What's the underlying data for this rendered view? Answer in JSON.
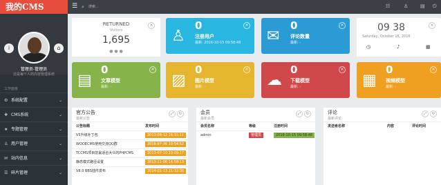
{
  "app": {
    "logo": "我的CMS"
  },
  "profile": {
    "name": "管理员-管理员",
    "desc": "这是每个人的内容管理系统",
    "left_icon": "info-icon",
    "right_icon": "home-icon"
  },
  "menu": {
    "heading": "工作面板",
    "items": [
      {
        "label": "系统配置",
        "icon": "gear-icon"
      },
      {
        "label": "CMS系统",
        "icon": "plus-icon"
      },
      {
        "label": "专题管理",
        "icon": "star-icon"
      },
      {
        "label": "用户管理",
        "icon": "user-icon"
      },
      {
        "label": "站内信息",
        "icon": "envelope-icon"
      },
      {
        "label": "碎片管理",
        "icon": "list-icon"
      }
    ]
  },
  "topbar": {
    "search_placeholder": "搜索..."
  },
  "returned": {
    "title": "RETURNED",
    "sub": "Visitors",
    "value": "1,695"
  },
  "clock": {
    "time": "09 38",
    "date": "Saturday, October 15, 2016"
  },
  "stats": [
    {
      "value": "0",
      "label": "注册用户",
      "sub": "最新: 2016-10-15 09:58:48",
      "color": "#29b6e0",
      "icon": "user-icon"
    },
    {
      "value": "0",
      "label": "评论数量",
      "sub": "最新: -",
      "color": "#2a9bd4",
      "icon": "envelope-icon"
    },
    {
      "value": "0",
      "label": "文章模型",
      "sub": "最新: -",
      "color": "#86b44a",
      "icon": "newspaper-icon"
    },
    {
      "value": "0",
      "label": "图片模型",
      "sub": "最新: -",
      "color": "#e6b52e",
      "icon": "image-icon"
    },
    {
      "value": "0",
      "label": "下载模型",
      "sub": "最新: -",
      "color": "#d0484a",
      "icon": "cloud-download-icon"
    },
    {
      "value": "0",
      "label": "视频模型",
      "sub": "最新: -",
      "color": "#f0a020",
      "icon": "film-icon"
    }
  ],
  "announce": {
    "title": "官方公告",
    "sub": "最新公告",
    "col1": "公告标题",
    "col2": "发布时间",
    "rows": [
      {
        "t": "V5升级补丁包",
        "d": "2013-08-12 16:31:11"
      },
      {
        "t": "WOOECMS使用交流QQ群",
        "d": "2016-07-26 10:54:52"
      },
      {
        "t": "TCCMS项目前最适合大众的PHPCMS",
        "d": "2013-07-10 23:09:17"
      },
      {
        "t": "静态模式路径设置",
        "d": "2013-11-06 16:58:13"
      },
      {
        "t": "V8.0 BBS插件发布",
        "d": "2014-01-13 21:32:36"
      }
    ]
  },
  "members": {
    "title": "会员",
    "sub": "最新会员",
    "col1": "会员名称",
    "col2": "等级",
    "col3": "注册时间",
    "rows": [
      {
        "name": "admin",
        "level": "管理员",
        "time": "2016-10-15 09:58:48"
      }
    ]
  },
  "comments": {
    "title": "评论",
    "sub": "最新评论",
    "col1": "发送者名称",
    "col2": "内容",
    "col3": "评论时间"
  }
}
